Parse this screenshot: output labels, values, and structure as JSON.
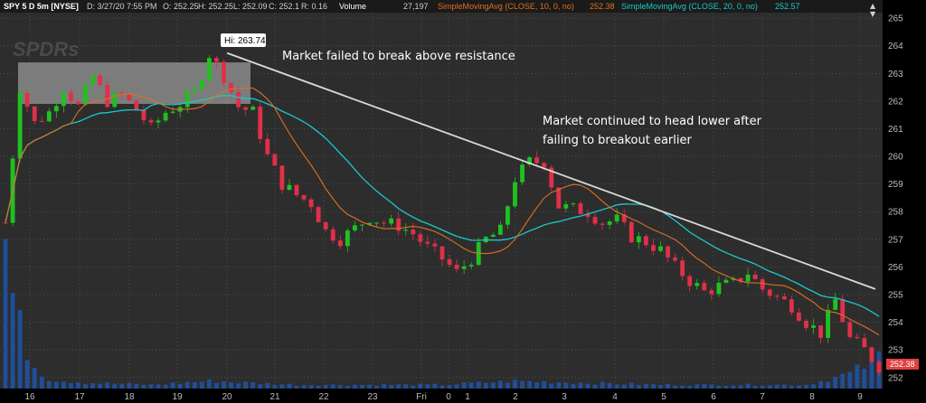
{
  "header": {
    "symbol": "SPY 5 D 5m [NYSE]",
    "date": "D: 3/27/20 7:55 PM",
    "open": "O: 252.25",
    "high": "H: 252.25",
    "low": "L: 252.09",
    "close": "C: 252.1",
    "range": "R: 0.16",
    "volume_label": "Volume",
    "volume_value": "27,197",
    "sma10_label": "SimpleMovingAvg (CLOSE, 10, 0, no)",
    "sma10_value": "252.38",
    "sma20_label": "SimpleMovingAvg (CLOSE, 20, 0, no)",
    "sma20_value": "252.57"
  },
  "watermark": "SPDRs",
  "colors": {
    "background": "#2d2d2d",
    "grid": "#555555",
    "up": "#21c021",
    "down": "#e0304a",
    "sma10": "#e07020",
    "sma20": "#1cc8c8",
    "volume": "#1f4e9a",
    "trendline": "#d9d9d9",
    "resistance_box": "#a8a8a8",
    "last_price_tag": "#e04040"
  },
  "chart_data": {
    "type": "candlestick",
    "ylim": [
      251.6,
      265.2
    ],
    "y_ticks": [
      252,
      253,
      254,
      255,
      256,
      257,
      258,
      259,
      260,
      261,
      262,
      263,
      264,
      265
    ],
    "x_tick_labels": [
      "16",
      "17",
      "18",
      "19",
      "20",
      "21",
      "22",
      "23",
      "Fri",
      "0",
      "1",
      "2",
      "3",
      "4",
      "5",
      "6",
      "7",
      "8",
      "9"
    ],
    "high_label": "Hi: 263.74",
    "last_price": "252.38",
    "resistance_zone": {
      "low": 261.9,
      "high": 263.4
    },
    "trendline": {
      "start": 263.74,
      "end": 255.2
    },
    "price_path": [
      [
        0,
        257.6
      ],
      [
        2,
        262.5
      ],
      [
        4,
        261.2
      ],
      [
        6,
        261.6
      ],
      [
        8,
        262.5
      ],
      [
        10,
        261.8
      ],
      [
        12,
        262.9
      ],
      [
        14,
        262.0
      ],
      [
        16,
        262.2
      ],
      [
        18,
        261.7
      ],
      [
        20,
        261.0
      ],
      [
        22,
        261.6
      ],
      [
        24,
        261.9
      ],
      [
        26,
        262.3
      ],
      [
        28,
        263.7
      ],
      [
        30,
        262.9
      ],
      [
        32,
        261.8
      ],
      [
        34,
        261.6
      ],
      [
        36,
        260.0
      ],
      [
        38,
        259.0
      ],
      [
        40,
        258.6
      ],
      [
        42,
        258.3
      ],
      [
        44,
        257.3
      ],
      [
        46,
        257.0
      ],
      [
        48,
        257.4
      ],
      [
        50,
        257.8
      ],
      [
        52,
        257.6
      ],
      [
        54,
        257.5
      ],
      [
        56,
        257.2
      ],
      [
        58,
        256.7
      ],
      [
        60,
        256.3
      ],
      [
        62,
        255.8
      ],
      [
        64,
        256.3
      ],
      [
        66,
        257.0
      ],
      [
        68,
        257.3
      ],
      [
        70,
        259.2
      ],
      [
        72,
        259.8
      ],
      [
        74,
        259.8
      ],
      [
        76,
        258.2
      ],
      [
        78,
        258.1
      ],
      [
        80,
        258.0
      ],
      [
        82,
        257.6
      ],
      [
        84,
        257.7
      ],
      [
        86,
        257.1
      ],
      [
        88,
        256.9
      ],
      [
        90,
        256.6
      ],
      [
        92,
        256.0
      ],
      [
        94,
        255.5
      ],
      [
        96,
        255.1
      ],
      [
        98,
        255.3
      ],
      [
        100,
        255.4
      ],
      [
        102,
        255.8
      ],
      [
        104,
        255.2
      ],
      [
        106,
        254.9
      ],
      [
        108,
        254.6
      ],
      [
        110,
        254.0
      ],
      [
        112,
        253.6
      ],
      [
        114,
        254.8
      ],
      [
        116,
        253.4
      ],
      [
        118,
        253.0
      ],
      [
        120,
        252.4
      ]
    ],
    "volume_path": [
      [
        0,
        0.78
      ],
      [
        1,
        0.5
      ],
      [
        2,
        0.33
      ],
      [
        3,
        0.2
      ],
      [
        4,
        0.12
      ],
      [
        6,
        0.05
      ],
      [
        8,
        0.04
      ],
      [
        12,
        0.03
      ],
      [
        20,
        0.02
      ],
      [
        28,
        0.04
      ],
      [
        40,
        0.02
      ],
      [
        60,
        0.02
      ],
      [
        70,
        0.04
      ],
      [
        90,
        0.02
      ],
      [
        110,
        0.02
      ],
      [
        116,
        0.08
      ],
      [
        118,
        0.12
      ],
      [
        120,
        0.18
      ]
    ],
    "annotations": [
      "Market failed to break above resistance",
      "Market continued to head lower after",
      "failing to breakout earlier"
    ]
  }
}
